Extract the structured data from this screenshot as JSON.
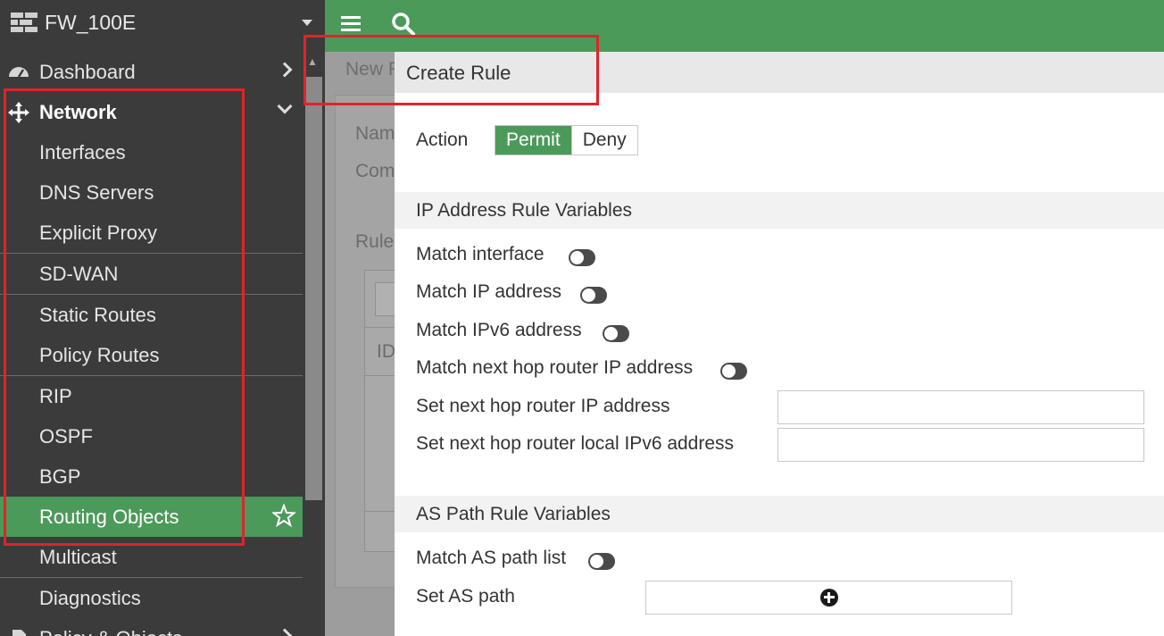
{
  "app": {
    "device_name": "FW_100E"
  },
  "sidebar": {
    "items": [
      {
        "label": "Dashboard",
        "icon": "dashboard-icon"
      },
      {
        "label": "Network",
        "icon": "network-move-icon"
      },
      {
        "label": "Interfaces"
      },
      {
        "label": "DNS Servers"
      },
      {
        "label": "Explicit Proxy"
      },
      {
        "label": "SD-WAN"
      },
      {
        "label": "Static Routes"
      },
      {
        "label": "Policy Routes"
      },
      {
        "label": "RIP"
      },
      {
        "label": "OSPF"
      },
      {
        "label": "BGP"
      },
      {
        "label": "Routing Objects",
        "active": true
      },
      {
        "label": "Multicast"
      },
      {
        "label": "Diagnostics"
      },
      {
        "label": "Policy & Objects"
      }
    ]
  },
  "background_page": {
    "tab_fragment": "New R",
    "name_fragment": "Nam",
    "comment_fragment": "Com",
    "rules_fragment": "Rule",
    "id_fragment": "ID"
  },
  "modal": {
    "title": "Create Rule",
    "action_label": "Action",
    "action_options": [
      "Permit",
      "Deny"
    ],
    "action_selected": "Permit",
    "ip_section": {
      "title": "IP Address Rule Variables",
      "toggles": [
        "Match interface",
        "Match IP address",
        "Match IPv6 address",
        "Match next hop router IP address"
      ],
      "fields": [
        {
          "label": "Set next hop router IP address",
          "value": ""
        },
        {
          "label": "Set next hop router local IPv6 address",
          "value": ""
        }
      ]
    },
    "as_section": {
      "title": "AS Path Rule Variables",
      "toggle": "Match AS path list",
      "set_as_path_label": "Set AS path"
    }
  },
  "colors": {
    "accent_green": "#4c9a5a",
    "sidebar_bg": "#3b3b3b",
    "highlight_red": "#e0232b"
  }
}
